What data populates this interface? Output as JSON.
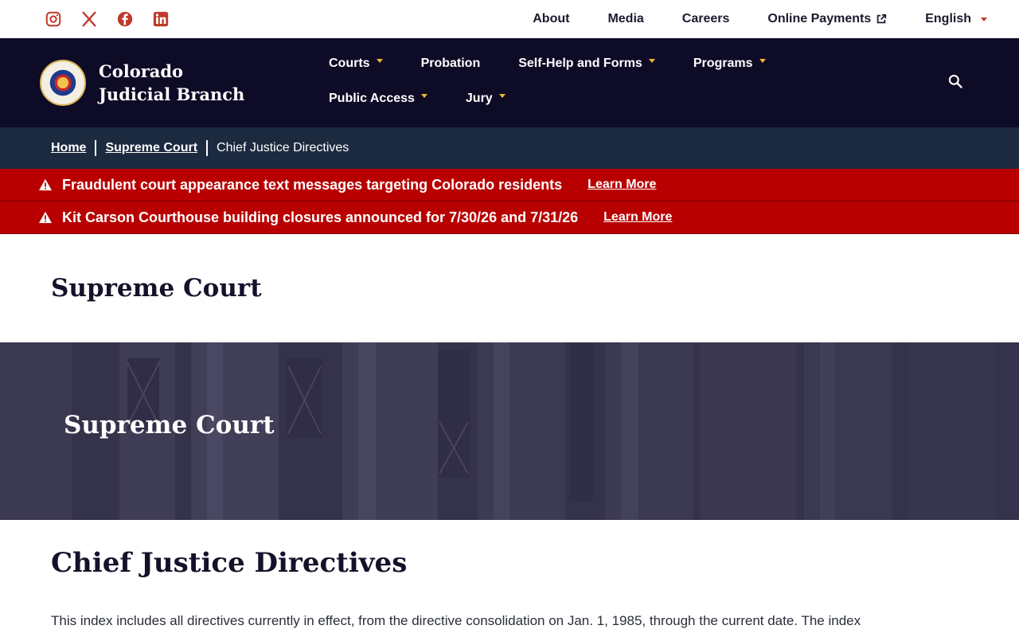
{
  "utility": {
    "social": [
      "instagram-icon",
      "x-icon",
      "facebook-icon",
      "linkedin-icon"
    ],
    "links": [
      {
        "label": "About"
      },
      {
        "label": "Media"
      },
      {
        "label": "Careers"
      },
      {
        "label": "Online Payments"
      },
      {
        "label": "English"
      }
    ]
  },
  "brand": {
    "name": "Colorado Judicial Branch"
  },
  "nav": {
    "items": [
      {
        "label": "Courts"
      },
      {
        "label": "Probation"
      },
      {
        "label": "Self-Help and Forms"
      },
      {
        "label": "Programs"
      },
      {
        "label": "Public Access"
      },
      {
        "label": "Jury"
      }
    ]
  },
  "breadcrumb": {
    "items": [
      {
        "label": "Home"
      },
      {
        "label": "Supreme Court"
      },
      {
        "label": "Chief Justice Directives"
      }
    ]
  },
  "alerts": [
    {
      "text": "Fraudulent court appearance text messages targeting Colorado residents",
      "link": "Learn More"
    },
    {
      "text": "Kit Carson Courthouse building closures announced for 7/30/26 and 7/31/26",
      "link": "Learn More"
    }
  ],
  "page": {
    "heading": "Supreme Court",
    "hero_title": "Supreme Court",
    "title": "Chief Justice Directives",
    "intro": "This index includes all directives currently in effect, from the directive consolidation on Jan. 1, 1985, through the current date. The index"
  },
  "colors": {
    "nav_bg": "#0d0b26",
    "breadcrumb_bg": "#1c2a3f",
    "alert_bg": "#b80000",
    "accent_red": "#c0392b",
    "accent_gold": "#f2b632"
  }
}
